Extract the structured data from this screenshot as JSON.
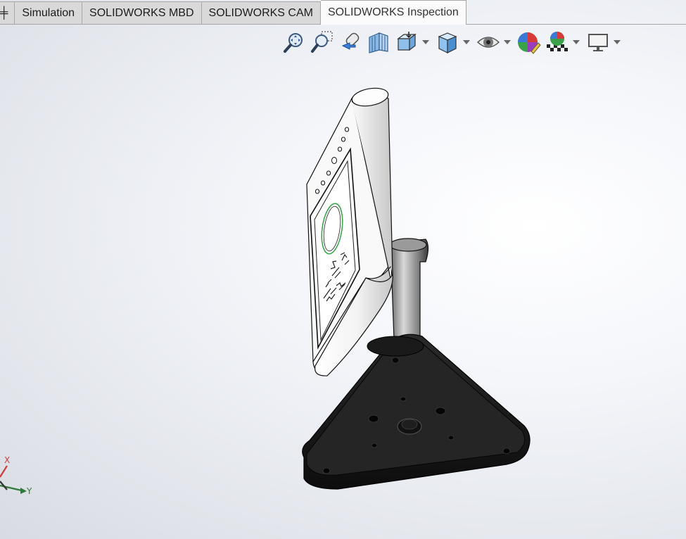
{
  "tabs": [
    {
      "label": "╪",
      "active": false
    },
    {
      "label": "Simulation",
      "active": false
    },
    {
      "label": "SOLIDWORKS MBD",
      "active": false
    },
    {
      "label": "SOLIDWORKS CAM",
      "active": false
    },
    {
      "label": "SOLIDWORKS Inspection",
      "active": true
    }
  ],
  "view_toolbar": [
    {
      "icon": "zoom-to-fit-icon"
    },
    {
      "icon": "zoom-to-area-icon"
    },
    {
      "icon": "previous-view-icon"
    },
    {
      "icon": "section-view-icon"
    },
    {
      "icon": "view-orientation-icon",
      "dropdown": true
    },
    {
      "icon": "display-style-icon",
      "dropdown": true
    },
    {
      "icon": "hide-show-items-icon",
      "dropdown": true
    },
    {
      "icon": "edit-appearance-icon"
    },
    {
      "icon": "apply-scene-icon",
      "dropdown": true
    },
    {
      "icon": "view-settings-icon",
      "dropdown": true
    }
  ],
  "triad": {
    "x_label": "X",
    "y_label": "Y",
    "x_color": "#d23a3a",
    "y_color": "#2f7a3a"
  },
  "colors": {
    "base": "#1e1e1e",
    "housing": "#f7f7f7",
    "ring_accent": "#3aa84a",
    "outline": "#111111"
  }
}
